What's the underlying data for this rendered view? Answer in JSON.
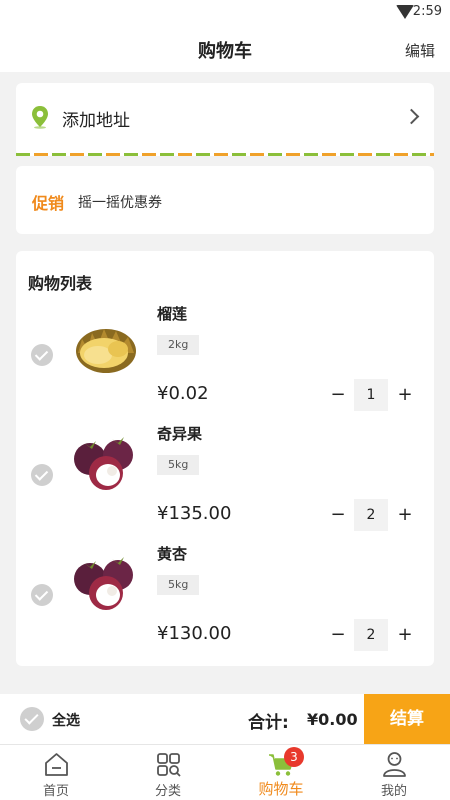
{
  "status_bar": {
    "time": "2:59",
    "wifi_icon": "wifi-icon"
  },
  "header": {
    "title": "购物车",
    "edit_label": "编辑"
  },
  "address": {
    "label": "添加地址",
    "icon": "location-pin-icon"
  },
  "promo": {
    "tag": "促销",
    "text": "摇一摇优惠券"
  },
  "cart": {
    "heading": "购物列表",
    "items": [
      {
        "name": "榴莲",
        "spec": "2kg",
        "price": "¥0.02",
        "quantity": "1",
        "image": "durian-image",
        "selected": false
      },
      {
        "name": "奇异果",
        "spec": "5kg",
        "price": "¥135.00",
        "quantity": "2",
        "image": "mangosteen-image",
        "selected": false
      },
      {
        "name": "黄杏",
        "spec": "5kg",
        "price": "¥130.00",
        "quantity": "2",
        "image": "mangosteen-image",
        "selected": false
      }
    ],
    "minus_label": "−",
    "plus_label": "+"
  },
  "summary": {
    "select_all": "全选",
    "total_label": "合计:",
    "total_value": "¥0.00",
    "checkout": "结算"
  },
  "tabs": [
    {
      "label": "首页",
      "icon": "home-icon"
    },
    {
      "label": "分类",
      "icon": "category-icon"
    },
    {
      "label": "购物车",
      "icon": "cart-icon",
      "badge": "3"
    },
    {
      "label": "我的",
      "icon": "profile-icon"
    }
  ],
  "colors": {
    "accent": "#f7a416",
    "promo": "#f08a1c",
    "badge": "#e8392c",
    "pin": "#8bbf3a",
    "check": "#cfcfcf"
  }
}
